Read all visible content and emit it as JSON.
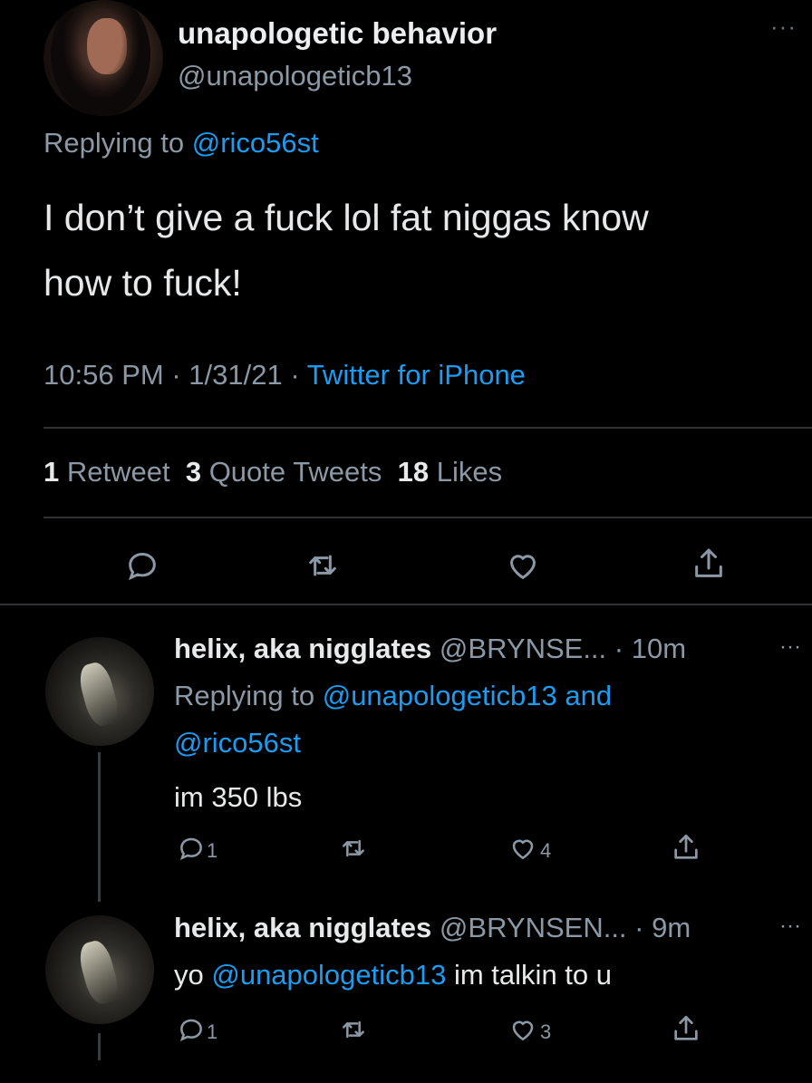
{
  "main": {
    "name": "unapologetic behavior",
    "handle": "@unapologeticb13",
    "replying_prefix": "Replying to ",
    "replying_to": "@rico56st",
    "text_line1": "I don’t give a fuck lol fat niggas know",
    "text_line2": "how to fuck!",
    "time": "10:56 PM",
    "date": "1/31/21",
    "source": "Twitter for iPhone",
    "sep": " · ",
    "retweets": "1",
    "retweets_label": " Retweet",
    "quotes": "3",
    "quotes_label": " Quote Tweets",
    "likes": "18",
    "likes_label": " Likes",
    "more": "···"
  },
  "replies": [
    {
      "name": "helix, aka nigglates",
      "handle": "@BRYNSE...",
      "time": "· 10m",
      "replying_prefix": "Replying to ",
      "replying_to_1": "@unapologeticb13",
      "replying_and": " and",
      "replying_to_2": "@rico56st",
      "text": "im 350 lbs",
      "reply_count": "1",
      "like_count": "4",
      "more": "···"
    },
    {
      "name": "helix, aka nigglates",
      "handle": "@BRYNSEN...",
      "time": "· 9m",
      "text_prefix": "yo ",
      "mention": "@unapologeticb13",
      "text_suffix": " im talkin to u",
      "reply_count": "1",
      "like_count": "3",
      "more": "···"
    }
  ],
  "icons": [
    "reply-icon",
    "retweet-icon",
    "like-icon",
    "share-icon"
  ],
  "colors": {
    "background": "#000000",
    "link": "#1d9bf0",
    "secondary": "#8b98a5",
    "divider": "#2f3336"
  }
}
